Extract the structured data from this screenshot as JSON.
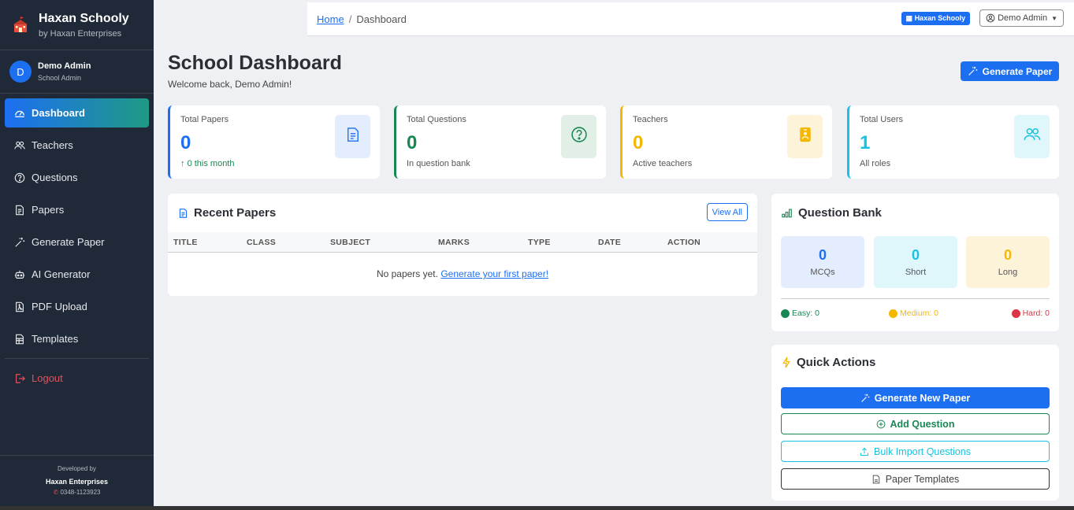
{
  "brand": {
    "title": "Haxan Schooly",
    "subtitle": "by Haxan Enterprises"
  },
  "user": {
    "initial": "D",
    "name": "Demo Admin",
    "role": "School Admin"
  },
  "nav": {
    "items": [
      {
        "label": "Dashboard",
        "icon": "gauge-icon"
      },
      {
        "label": "Teachers",
        "icon": "people-icon"
      },
      {
        "label": "Questions",
        "icon": "question-circle-icon"
      },
      {
        "label": "Papers",
        "icon": "file-text-icon"
      },
      {
        "label": "Generate Paper",
        "icon": "magic-wand-icon"
      },
      {
        "label": "AI Generator",
        "icon": "robot-icon"
      },
      {
        "label": "PDF Upload",
        "icon": "file-pdf-icon"
      },
      {
        "label": "Templates",
        "icon": "file-ruled-icon"
      }
    ],
    "logout": "Logout"
  },
  "developer": {
    "line1": "Developed by",
    "line2": "Haxan Enterprises",
    "phone": "0348-1123923"
  },
  "topbar": {
    "breadcrumb_home": "Home",
    "breadcrumb_sep": "/",
    "breadcrumb_current": "Dashboard",
    "school_badge": "Haxan Schooly",
    "admin_label": "Demo Admin"
  },
  "header": {
    "title": "School Dashboard",
    "subtitle": "Welcome back, Demo Admin!",
    "generate_label": "Generate Paper"
  },
  "stats": [
    {
      "label": "Total Papers",
      "value": "0",
      "foot": "0 this month",
      "color": "#1d6ff2",
      "icon": "file-text-icon"
    },
    {
      "label": "Total Questions",
      "value": "0",
      "foot": "In question bank",
      "color": "#198754",
      "icon": "question-circle-icon"
    },
    {
      "label": "Teachers",
      "value": "0",
      "foot": "Active teachers",
      "color": "#f5b800",
      "icon": "person-badge-icon"
    },
    {
      "label": "Total Users",
      "value": "1",
      "foot": "All roles",
      "color": "#17c3e0",
      "icon": "people-icon"
    }
  ],
  "recent": {
    "title": "Recent Papers",
    "view_all": "View All",
    "columns": [
      "TITLE",
      "CLASS",
      "SUBJECT",
      "MARKS",
      "TYPE",
      "DATE",
      "ACTION"
    ],
    "empty_text": "No papers yet.",
    "empty_link": "Generate your first paper!"
  },
  "qbank": {
    "title": "Question Bank",
    "boxes": [
      {
        "value": "0",
        "label": "MCQs"
      },
      {
        "value": "0",
        "label": "Short"
      },
      {
        "value": "0",
        "label": "Long"
      }
    ],
    "easy": "Easy: 0",
    "medium": "Medium: 0",
    "hard": "Hard: 0"
  },
  "quick": {
    "title": "Quick Actions",
    "generate": "Generate New Paper",
    "add": "Add Question",
    "bulk": "Bulk Import Questions",
    "templates": "Paper Templates"
  }
}
